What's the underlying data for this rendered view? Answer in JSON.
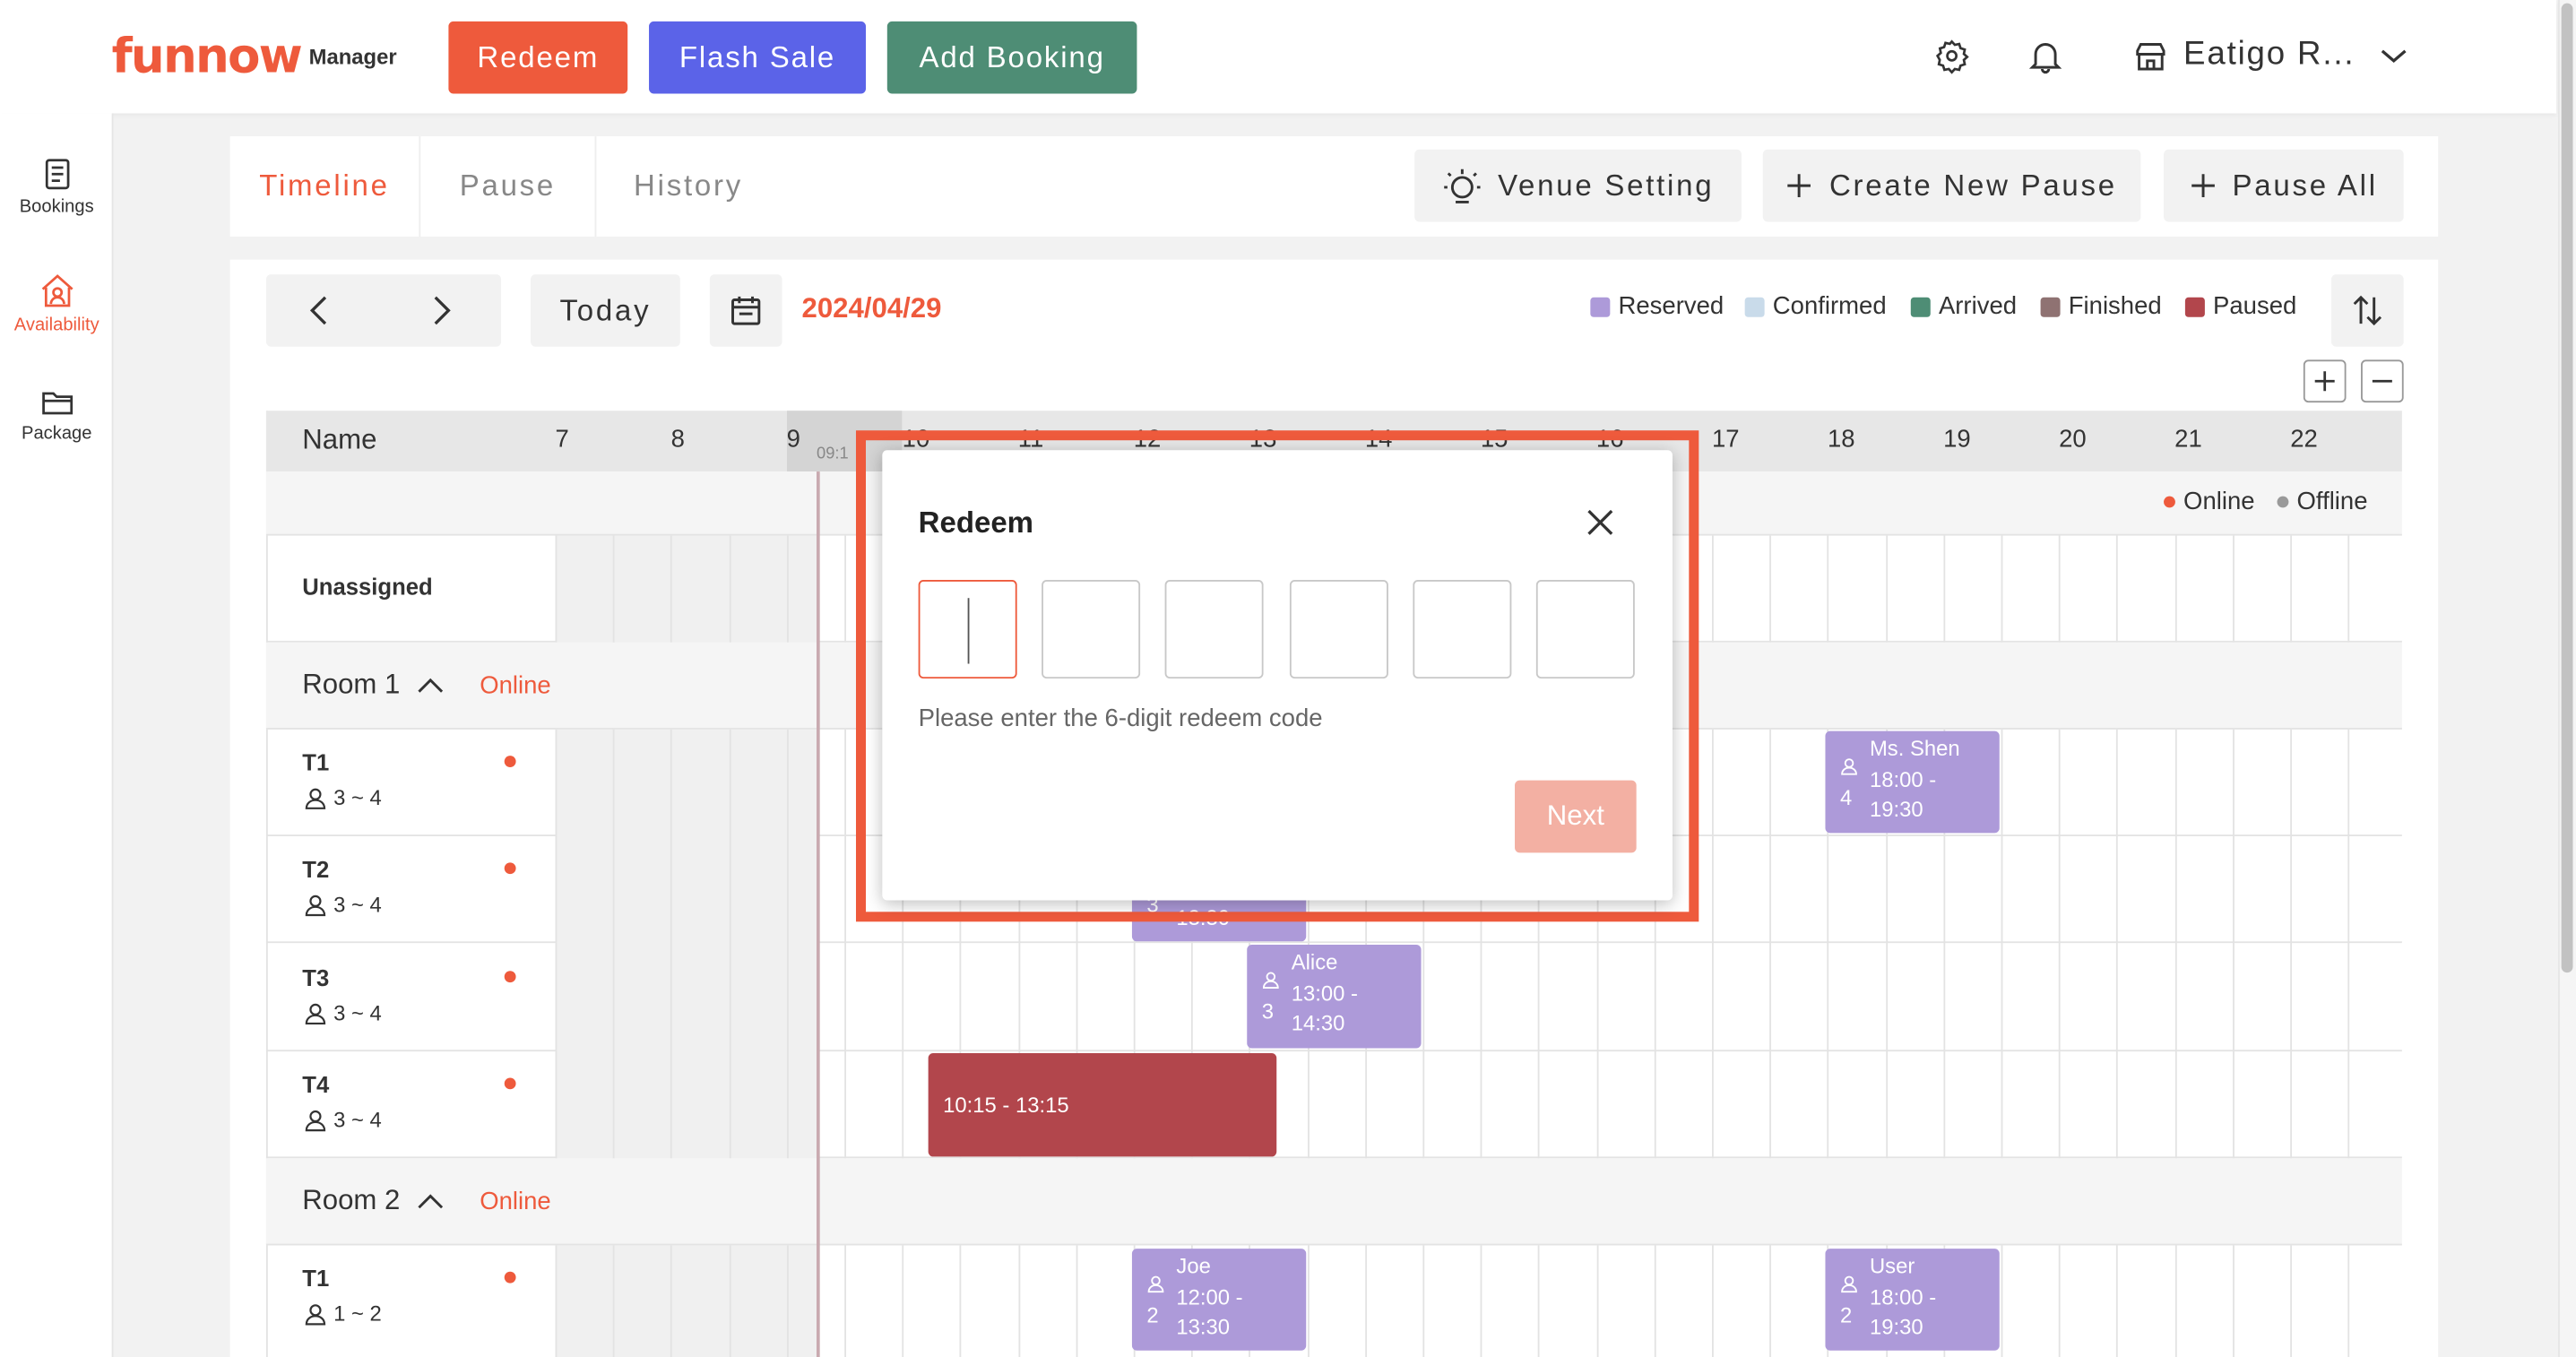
{
  "header": {
    "logo": "funnow",
    "logo_sub": "Manager",
    "redeem_label": "Redeem",
    "flash_sale_label": "Flash Sale",
    "add_booking_label": "Add Booking",
    "venue_name": "Eatigo R...",
    "colors": {
      "redeem": "#ee5a3c",
      "flash_sale": "#5b63e8",
      "add_booking": "#4e8d75"
    }
  },
  "sidebar": {
    "items": [
      {
        "label": "Bookings",
        "icon": "document-icon"
      },
      {
        "label": "Availability",
        "icon": "store-icon",
        "active": true
      },
      {
        "label": "Package",
        "icon": "folder-icon"
      }
    ]
  },
  "tabs": [
    {
      "label": "Timeline",
      "active": true
    },
    {
      "label": "Pause"
    },
    {
      "label": "History"
    }
  ],
  "actions": {
    "venue_setting": "Venue Setting",
    "create_pause": "Create New Pause",
    "pause_all": "Pause All"
  },
  "toolbar": {
    "today": "Today",
    "date": "2024/04/29"
  },
  "legend": [
    {
      "label": "Reserved",
      "color": "#ad9ad9"
    },
    {
      "label": "Confirmed",
      "color": "#c9dbea"
    },
    {
      "label": "Arrived",
      "color": "#4e8d75"
    },
    {
      "label": "Finished",
      "color": "#8f7272"
    },
    {
      "label": "Paused",
      "color": "#b2464c"
    }
  ],
  "timeline": {
    "name_header": "Name",
    "hours": [
      "7",
      "8",
      "9",
      "10",
      "11",
      "12",
      "13",
      "14",
      "15",
      "16",
      "17",
      "18",
      "19",
      "20",
      "21",
      "22"
    ],
    "now_label": "09:1",
    "online_legend": "Online",
    "offline_legend": "Offline",
    "unassigned": "Unassigned",
    "rooms": [
      {
        "name": "Room 1",
        "status": "Online",
        "tables": [
          {
            "name": "T1",
            "capacity": "3 ~ 4"
          },
          {
            "name": "T2",
            "capacity": "3 ~ 4"
          },
          {
            "name": "T3",
            "capacity": "3 ~ 4"
          },
          {
            "name": "T4",
            "capacity": "3 ~ 4"
          }
        ]
      },
      {
        "name": "Room 2",
        "status": "Online",
        "tables": [
          {
            "name": "T1",
            "capacity": "1 ~ 2"
          }
        ]
      }
    ],
    "bookings": [
      {
        "name": "Ms. Shen",
        "persons": "4",
        "time": "18:00 - 19:30"
      },
      {
        "name": "",
        "persons": "3",
        "time": "13:30"
      },
      {
        "name": "Alice",
        "persons": "3",
        "time": "13:00 - 14:30"
      },
      {
        "name": "Joe",
        "persons": "2",
        "time": "12:00 - 13:30"
      },
      {
        "name": "User",
        "persons": "2",
        "time": "18:00 - 19:30"
      }
    ],
    "pause": {
      "time": "10:15 - 13:15"
    }
  },
  "modal": {
    "title": "Redeem",
    "hint": "Please enter the 6-digit redeem code",
    "next_label": "Next",
    "code_digits": [
      "",
      "",
      "",
      "",
      "",
      ""
    ]
  }
}
